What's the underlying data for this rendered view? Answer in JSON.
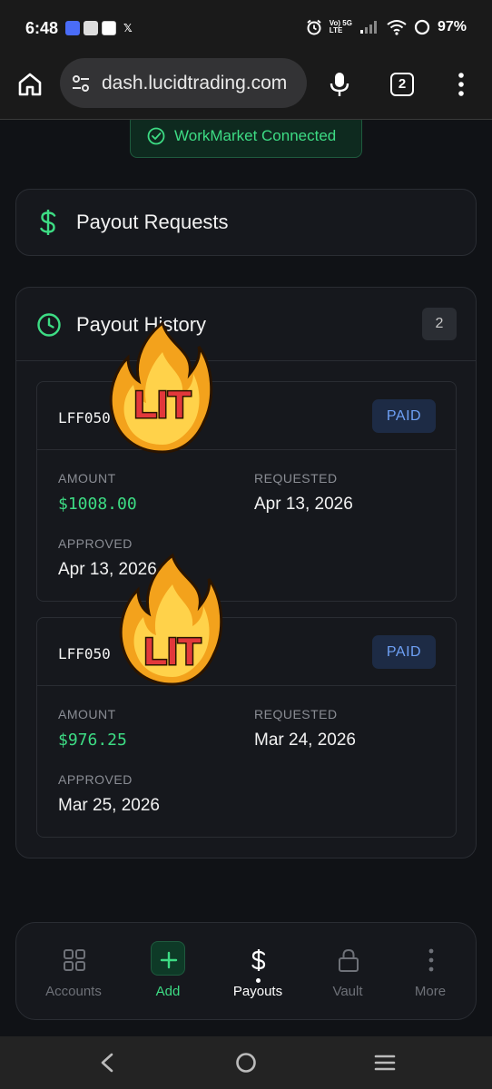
{
  "status_bar": {
    "time": "6:48",
    "network_top": "Vo) 5G",
    "network_bottom": "LTE",
    "battery": "97%"
  },
  "browser": {
    "url": "dash.lucidtrading.com",
    "tab_count": "2"
  },
  "banner": {
    "label": "WorkMarket Connected"
  },
  "payout_requests": {
    "title": "Payout Requests",
    "icon": "dollar-icon"
  },
  "payout_history": {
    "title": "Payout History",
    "count": "2",
    "items": [
      {
        "id": "LFF050",
        "status": "PAID",
        "amount_label": "AMOUNT",
        "amount": "$1008.00",
        "requested_label": "REQUESTED",
        "requested": "Apr 13, 2026",
        "approved_label": "APPROVED",
        "approved": "Apr 13, 2026"
      },
      {
        "id": "LFF050",
        "status": "PAID",
        "amount_label": "AMOUNT",
        "amount": "$976.25",
        "requested_label": "REQUESTED",
        "requested": "Mar 24, 2026",
        "approved_label": "APPROVED",
        "approved": "Mar 25, 2026"
      }
    ]
  },
  "stickers": [
    "LIT",
    "LIT"
  ],
  "bottom_nav": {
    "items": [
      {
        "label": "Accounts",
        "icon": "grid-icon"
      },
      {
        "label": "Add",
        "icon": "plus-icon"
      },
      {
        "label": "Payouts",
        "icon": "dollar-icon",
        "active": true
      },
      {
        "label": "Vault",
        "icon": "lock-icon"
      },
      {
        "label": "More",
        "icon": "more-vertical-icon"
      }
    ]
  },
  "colors": {
    "accent_green": "#3ddc84",
    "paid_badge_text": "#6ea0f5",
    "background": "#101216",
    "card": "#16181d"
  }
}
